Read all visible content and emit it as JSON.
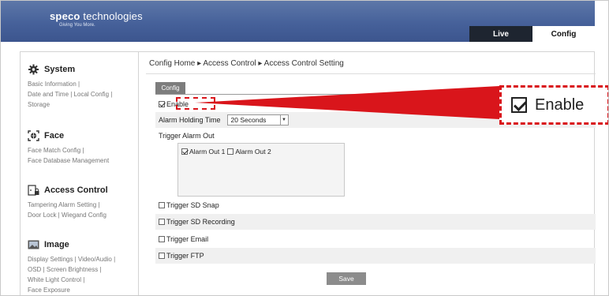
{
  "header": {
    "brand_bold": "speco",
    "brand_rest": " technologies",
    "tagline": "Giving You More.",
    "tabs": [
      {
        "label": "Live"
      },
      {
        "label": "Config"
      }
    ],
    "colors": {
      "header_bg": "#46619a",
      "live_tab_bg": "#1e2530"
    }
  },
  "sidebar": {
    "groups": [
      {
        "title": "System",
        "icon": "gear-icon",
        "links": [
          "Basic Information |",
          "Date and Time | Local Config |",
          "Storage"
        ]
      },
      {
        "title": "Face",
        "icon": "face-scan-icon",
        "links": [
          "Face Match Config |",
          "Face Database Management"
        ]
      },
      {
        "title": "Access Control",
        "icon": "door-lock-icon",
        "links": [
          "Tampering Alarm Setting |",
          "Door Lock | Wiegand Config"
        ]
      },
      {
        "title": "Image",
        "icon": "image-icon",
        "links": [
          "Display Settings | Video/Audio |",
          "OSD | Screen Brightness |",
          "White Light Control |",
          "Face Exposure"
        ]
      }
    ]
  },
  "content": {
    "breadcrumb": "Config Home ▸ Access Control ▸ Access Control Setting",
    "tab": "Config",
    "enable": {
      "label": "Enable",
      "checked": true
    },
    "alarm_holding_time": {
      "label": "Alarm Holding Time",
      "value": "20 Seconds"
    },
    "trigger_alarm_out": {
      "label": "Trigger Alarm Out",
      "outputs": [
        {
          "label": "Alarm Out 1",
          "checked": true
        },
        {
          "label": "Alarm Out 2",
          "checked": false
        }
      ]
    },
    "triggers": [
      {
        "label": "Trigger SD Snap",
        "checked": false
      },
      {
        "label": "Trigger SD Recording",
        "checked": false
      },
      {
        "label": "Trigger Email",
        "checked": false
      },
      {
        "label": "Trigger FTP",
        "checked": false
      }
    ],
    "save_label": "Save"
  },
  "callout": {
    "label": "Enable",
    "checked": true,
    "highlight_color": "#d9151b"
  }
}
